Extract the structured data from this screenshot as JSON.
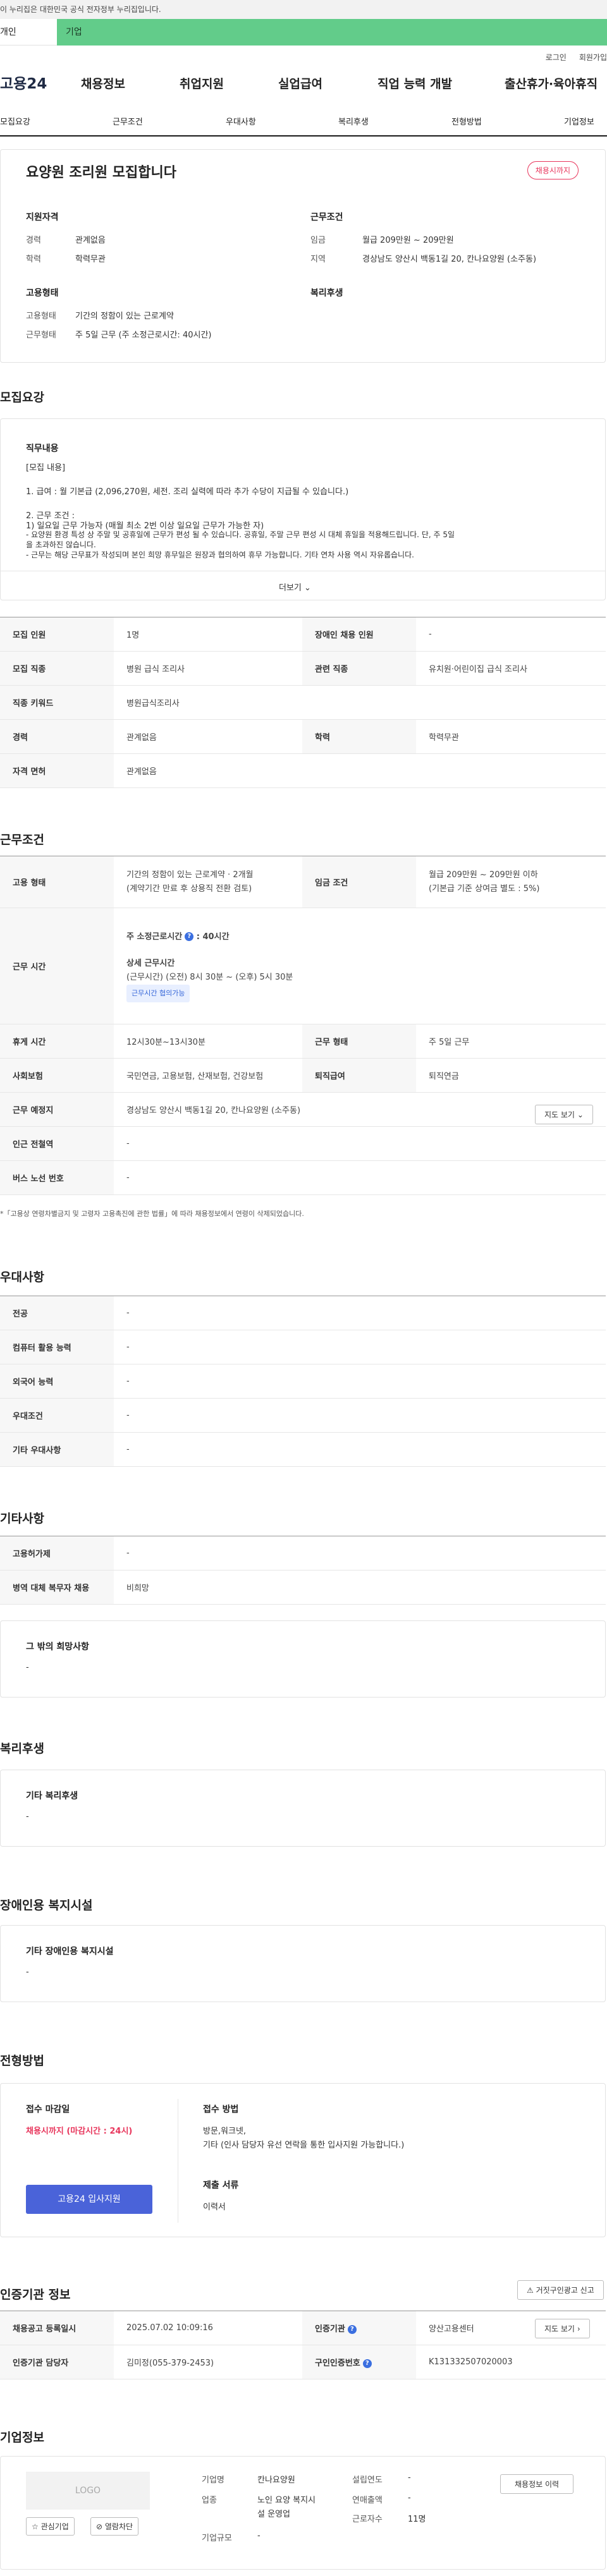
{
  "gov_bar": "이 누리집은 대한민국 공식 전자정부 누리집입니다.",
  "user_tabs": {
    "personal": "개인",
    "company": "기업"
  },
  "topbar": {
    "login": "로그인",
    "join": "회원가입"
  },
  "logo": "고용24",
  "gnb": [
    "채용정보",
    "취업지원",
    "실업급여",
    "직업 능력 개발",
    "출산휴가·육아휴직"
  ],
  "anchor_nav": [
    "모집요강",
    "근무조건",
    "우대사항",
    "복리후생",
    "전형방법",
    "기업정보"
  ],
  "header": {
    "title": "요양원 조리원 모집합니다",
    "status_badge": "채용시까지",
    "qual_title": "지원자격",
    "career_label": "경력",
    "career_value": "관계없음",
    "edu_label": "학력",
    "edu_value": "학력무관",
    "cond_title": "근무조건",
    "wage_label": "임금",
    "wage_value": "월급 209만원 ~ 209만원",
    "region_label": "지역",
    "region_value": "경상남도 양산시 백동1길 20, 칸나요양원 (소주동)",
    "type_title": "고용형태",
    "emp_label": "고용형태",
    "emp_value": "기간의 정함이 있는 근로계약",
    "work_label": "근무형태",
    "work_value": "주 5일 근무 (주 소정근로시간: 40시간)",
    "welfare_title": "복리후생"
  },
  "recruit": {
    "title": "모집요강",
    "duty_title": "직무내용",
    "lines": [
      "[모집 내용]",
      "1. 급여 : 월 기본급 (2,096,270원, 세전. 조리 실력에 따라 추가 수당이 지급될 수 있습니다.)",
      "2. 근무 조건 :",
      " 1) 일요일 근무 가능자 (매월 최소 2번 이상 일요일 근무가 가능한 자)",
      " - 요양원 환경 특성 상 주말 및 공휴일에 근무가 편성 될 수 있습니다. 공휴일, 주말 근무 편성 시 대체 휴일을 적용해드립니다. 단, 주 5일",
      "   을 초과하진 않습니다.",
      " - 근무는 해당 근무표가 작성되며 본인 희망 휴무일은 원장과 협의하여 휴무 가능합니다. 기타 연차 사용 역시 자유롭습니다."
    ],
    "more": "더보기",
    "rows": [
      {
        "k": "모집 인원",
        "v": "1명",
        "k2": "장애인 채용 인원",
        "v2": "-"
      },
      {
        "k": "모집 직종",
        "v": "병원 급식 조리사",
        "k2": "관련 직종",
        "v2": "유치원·어린이집 급식 조리사"
      },
      {
        "k": "직종 키워드",
        "v": "병원급식조리사"
      },
      {
        "k": "경력",
        "v": "관계없음",
        "k2": "학력",
        "v2": "학력무관"
      },
      {
        "k": "자격 면허",
        "v": "관계없음"
      }
    ]
  },
  "conditions": {
    "title": "근무조건",
    "emp_k": "고용 형태",
    "emp_v1": "기간의 정함이 있는 근로계약 · 2개월",
    "emp_v2": "(계약기간 만료 후 상용직 전환 검토)",
    "wage_k": "임금 조건",
    "wage_v1": "월급 209만원 ~ 209만원 이하",
    "wage_v2": "(기본급 기준 상여금 별도 : 5%)",
    "hours_k": "근무 시간",
    "hours_sum": "주 소정근로시간",
    "hours_sum_v": "40시간",
    "hours_detail_t": "상세 근무시간",
    "hours_detail_v": "(근무시간) (오전) 8시 30분 ~ (오후) 5시 30분",
    "hours_chip": "근무시간 협의가능",
    "break_k": "휴게 시간",
    "break_v": "12시30분~13시30분",
    "form_k": "근무 형태",
    "form_v": "주 5일 근무",
    "ins_k": "사회보험",
    "ins_v": "국민연금, 고용보험, 산재보험, 건강보험",
    "ret_k": "퇴직급여",
    "ret_v": "퇴직연금",
    "place_k": "근무 예정지",
    "place_v": "경상남도 양산시 백동1길 20, 칸나요양원 (소주동)",
    "map_btn": "지도 보기",
    "station_k": "인근 전철역",
    "station_v": "-",
    "bus_k": "버스 노선 번호",
    "bus_v": "-",
    "note": "*「고용상 연령차별금지 및 고령자 고용촉진에 관한 법률」에 따라 채용정보에서 연령이 삭제되었습니다."
  },
  "prefer": {
    "title": "우대사항",
    "rows": [
      {
        "k": "전공",
        "v": "-"
      },
      {
        "k": "컴퓨터 활용 능력",
        "v": "-"
      },
      {
        "k": "외국어 능력",
        "v": "-"
      },
      {
        "k": "우대조건",
        "v": "-"
      },
      {
        "k": "기타 우대사항",
        "v": "-"
      }
    ]
  },
  "etc": {
    "title": "기타사항",
    "rows": [
      {
        "k": "고용허가제",
        "v": "-"
      },
      {
        "k": "병역 대체 복무자 채용",
        "v": "비희망"
      }
    ],
    "box_title": "그 밖의 희망사항",
    "box_value": "-"
  },
  "welfare": {
    "title": "복리후생",
    "box_title": "기타 복리후생",
    "box_value": "-"
  },
  "disability": {
    "title": "장애인용 복지시설",
    "box_title": "기타 장애인용 복지시설",
    "box_value": "-"
  },
  "selection": {
    "title": "전형방법",
    "deadline_t": "접수 마감일",
    "deadline_v": "채용시까지 (마감시간 : 24시)",
    "apply_btn": "고용24 입사지원",
    "method_t": "접수 방법",
    "method_v1": "방문,워크넷,",
    "method_v2": "기타 (인사 담당자 유선 연락을 통한 입사지원 가능합니다.)",
    "docs_t": "제출 서류",
    "docs_v": "이력서"
  },
  "cert": {
    "title": "인증기관 정보",
    "report_btn": "거짓구인광고 신고",
    "reg_k": "채용공고 등록일시",
    "reg_v": "2025.07.02 10:09:16",
    "org_k": "인증기관",
    "org_v": "양산고용센터",
    "map_btn": "지도 보기",
    "mgr_k": "인증기관 담당자",
    "mgr_v": "김미정(055-379-2453)",
    "no_k": "구인인증번호",
    "no_v": "K131332507020003"
  },
  "company": {
    "title": "기업정보",
    "logo_text": "LOGO",
    "fav_btn": "관심기업",
    "block_btn": "열람차단",
    "name_k": "기업명",
    "name_v": "칸나요양원",
    "ind_k": "업종",
    "ind_v1": "노인 요양 복지시",
    "ind_v2": "설 운영업",
    "size_k": "기업규모",
    "size_v": "-",
    "est_k": "설립연도",
    "est_v": "-",
    "sales_k": "연매출액",
    "sales_v": "-",
    "emp_k": "근로자수",
    "emp_v": "11명",
    "info_btn": "채용정보 이력"
  }
}
